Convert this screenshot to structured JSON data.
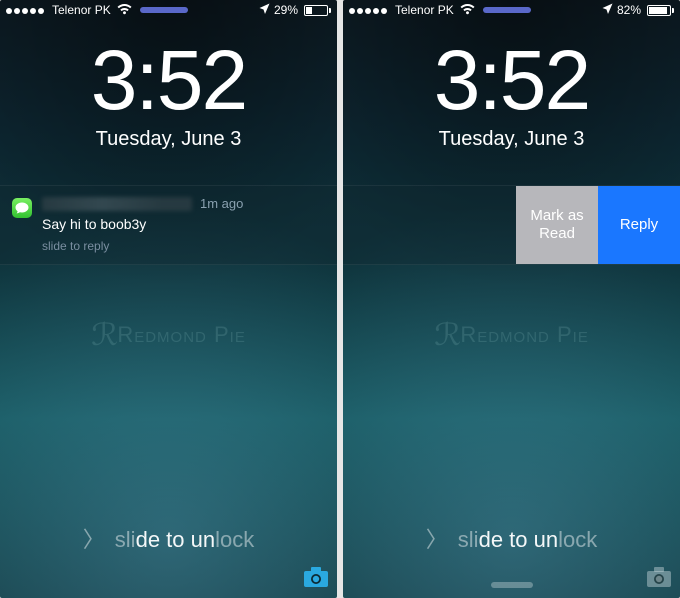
{
  "left": {
    "status": {
      "carrier": "Telenor PK",
      "battery_pct": "29%",
      "battery_level": 0.29
    },
    "time": "3:52",
    "date": "Tuesday, June 3",
    "notification": {
      "app": "messages",
      "time_ago": "1m ago",
      "message": "Say hi to boob3y",
      "hint": "slide to reply"
    },
    "watermark": "Redmond Pie",
    "unlock_dimmed": "sli",
    "unlock_bright": "de to un",
    "unlock_dimmed2": "lock"
  },
  "right": {
    "status": {
      "carrier": "Telenor PK",
      "battery_pct": "82%",
      "battery_level": 0.82
    },
    "time": "3:52",
    "date": "Tuesday, June 3",
    "actions": {
      "mark_read": "Mark as Read",
      "reply": "Reply"
    },
    "watermark": "Redmond Pie",
    "unlock_dimmed": "sli",
    "unlock_bright": "de to un",
    "unlock_dimmed2": "lock"
  }
}
